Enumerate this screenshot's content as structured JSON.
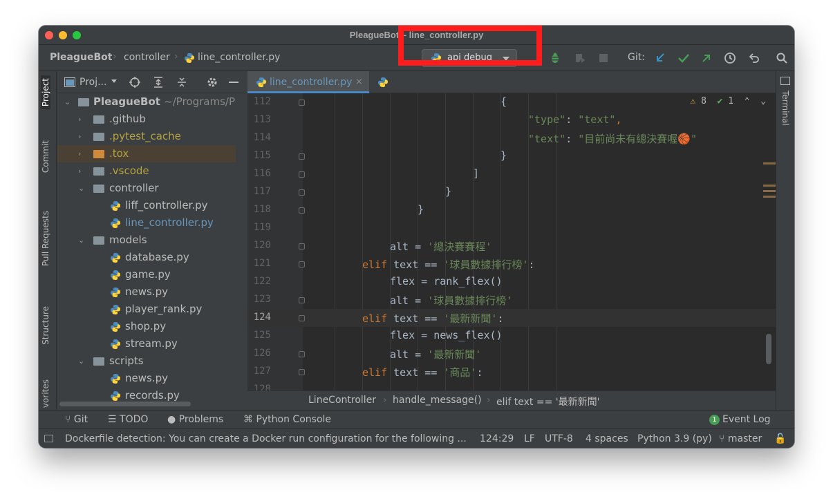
{
  "window": {
    "title": "PleagueBot – line_controller.py"
  },
  "navbar": {
    "crumbs": [
      "PleagueBot",
      "controller",
      "line_controller.py"
    ],
    "run_config": "api debug",
    "git_label": "Git:"
  },
  "left_stripe": [
    "Project",
    "Commit",
    "Pull Requests",
    "Structure",
    "vorites"
  ],
  "project": {
    "title": "Proj...",
    "tree": [
      {
        "name": "PleagueBot",
        "extra": "~/Programs/P"
      },
      {
        "name": ".github"
      },
      {
        "name": ".pytest_cache"
      },
      {
        "name": ".tox"
      },
      {
        "name": ".vscode"
      },
      {
        "name": "controller"
      },
      {
        "name": "liff_controller.py"
      },
      {
        "name": "line_controller.py"
      },
      {
        "name": "models"
      },
      {
        "name": "database.py"
      },
      {
        "name": "game.py"
      },
      {
        "name": "news.py"
      },
      {
        "name": "player_rank.py"
      },
      {
        "name": "shop.py"
      },
      {
        "name": "stream.py"
      },
      {
        "name": "scripts"
      },
      {
        "name": "news.py"
      },
      {
        "name": "records.py"
      }
    ]
  },
  "editor": {
    "tabs": [
      {
        "label": "line_controller.py"
      }
    ],
    "inspections": {
      "warnings": "8",
      "ok": "1"
    },
    "lines": [
      {
        "num": "112"
      },
      {
        "num": "113"
      },
      {
        "num": "114"
      },
      {
        "num": "115"
      },
      {
        "num": "116"
      },
      {
        "num": "117"
      },
      {
        "num": "118"
      },
      {
        "num": "119"
      },
      {
        "num": "120"
      },
      {
        "num": "121"
      },
      {
        "num": "122"
      },
      {
        "num": "123"
      },
      {
        "num": "124"
      },
      {
        "num": "125"
      },
      {
        "num": "126"
      },
      {
        "num": "127"
      },
      {
        "num": "128"
      }
    ],
    "code": {
      "l112": "{",
      "l113_key": "\"type\"",
      "l113_colon": ": ",
      "l113_val": "\"text\"",
      "l113_comma": ",",
      "l114_key": "\"text\"",
      "l114_colon": ": ",
      "l114_val": "\"目前尚未有總決賽喔🏀\"",
      "l115": "}",
      "l116": "]",
      "l117": "}",
      "l118": "}",
      "l120_a": "alt = ",
      "l120_b": "'總決賽賽程'",
      "kw_elif": "elif",
      "l121_a": " text == ",
      "l121_b": "'球員數據排行榜'",
      "colon": ":",
      "l122": "flex = rank_flex()",
      "l123_a": "alt = ",
      "l123_b": "'球員數據排行榜'",
      "l124_a": " text == ",
      "l124_b": "'最新新聞'",
      "l125": "flex = news_flex()",
      "l126_a": "alt = ",
      "l126_b": "'最新新聞'",
      "l127_a": " text == ",
      "l127_b": "'商品'"
    },
    "breadcrumbs": [
      "LineController",
      "handle_message()",
      "elif text == '最新新聞'"
    ]
  },
  "right_stripe": {
    "terminal": "Terminal"
  },
  "bottom_tools": {
    "git": "Git",
    "todo": "TODO",
    "problems": "Problems",
    "python_console": "Python Console",
    "event_log_count": "1",
    "event_log": "Event Log"
  },
  "status": {
    "message": "Dockerfile detection: You can create a Docker run configuration for the following ...",
    "position": "124:29",
    "line_sep": "LF",
    "encoding": "UTF-8",
    "indent": "4 spaces",
    "interpreter": "Python 3.9 (py)",
    "branch": "master"
  },
  "colors": {
    "keyword": "#cc7832",
    "string": "#6a8759",
    "text": "#a9b7c6",
    "highlight": "#ff1c1c"
  }
}
